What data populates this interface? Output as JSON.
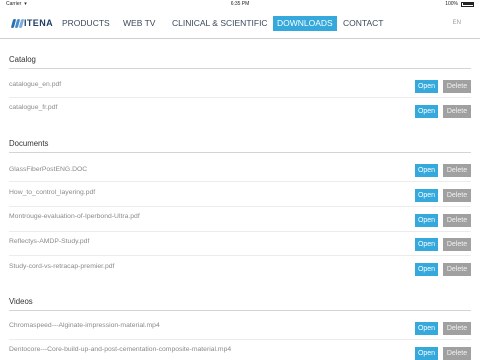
{
  "status_bar": {
    "carrier": "Carrier",
    "time": "6:35 PM",
    "battery": "100%"
  },
  "nav": {
    "logo_text": "ITENA",
    "items": [
      {
        "label": "PRODUCTS",
        "active": false
      },
      {
        "label": "WEB TV",
        "active": false
      },
      {
        "label": "CLINICAL & SCIENTIFIC",
        "active": false
      },
      {
        "label": "DOWNLOADS",
        "active": true
      },
      {
        "label": "CONTACT",
        "active": false
      }
    ],
    "language": "EN"
  },
  "actions": {
    "open_label": "Open",
    "delete_label": "Delete"
  },
  "sections": [
    {
      "title": "Catalog",
      "files": [
        "catalogue_en.pdf",
        "catalogue_fr.pdf"
      ]
    },
    {
      "title": "Documents",
      "files": [
        "GlassFiberPostENG.DOC",
        "How_to_control_layering.pdf",
        "Montrouge-evaluation-of-Iperbond-Ultra.pdf",
        "Reflectys-AMDP-Study.pdf",
        "Study-cord-vs-retracap-premier.pdf"
      ]
    },
    {
      "title": "Videos",
      "files": [
        "Chromaspeed---Alginate-impression-material.mp4",
        "Dentocore---Core-build-up-and-post-cementation-composite-material.mp4"
      ]
    }
  ],
  "colors": {
    "accent": "#35a8dc",
    "delete_button": "#a0a0a0",
    "logo": "#1f3d66"
  }
}
